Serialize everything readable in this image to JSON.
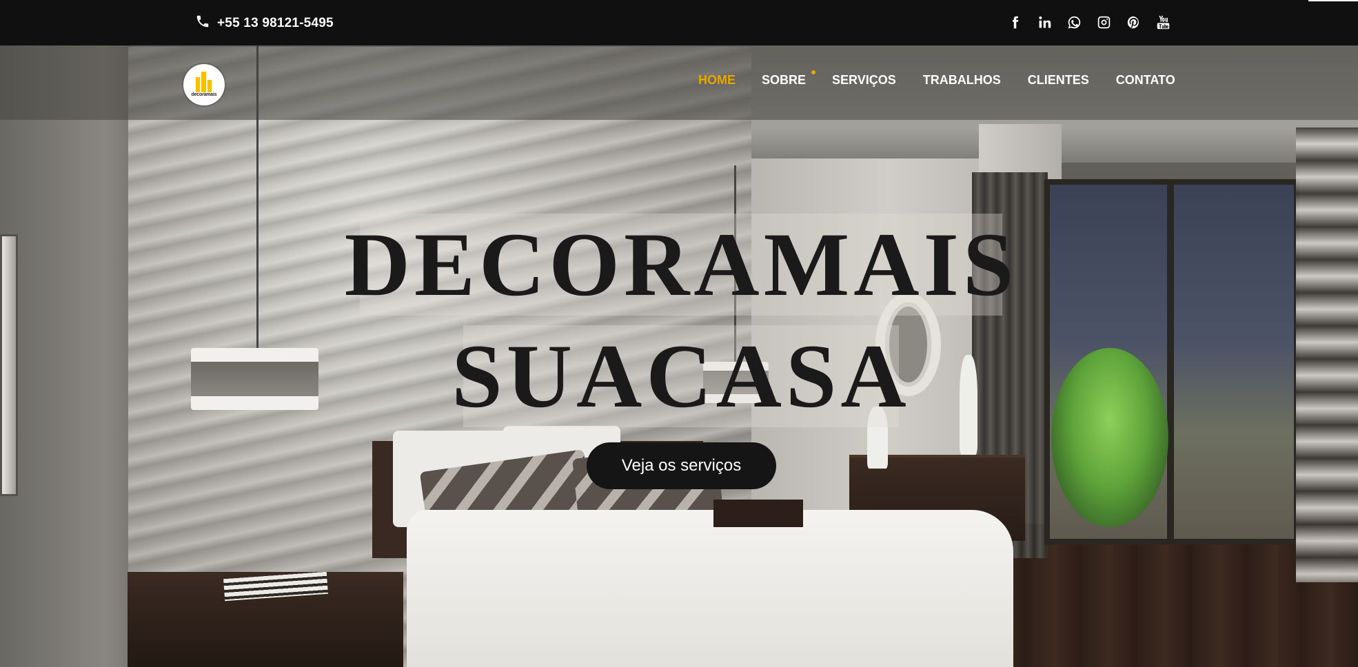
{
  "topbar": {
    "phone": "+55 13 98121-5495",
    "social_icons": [
      "facebook-icon",
      "linkedin-icon",
      "whatsapp-icon",
      "instagram-icon",
      "pinterest-icon",
      "youtube-icon"
    ]
  },
  "brand": {
    "logo_text": "decoramais"
  },
  "nav": {
    "items": [
      {
        "label": "HOME",
        "active": true
      },
      {
        "label": "SOBRE",
        "active": false
      },
      {
        "label": "SERVIÇOS",
        "active": false
      },
      {
        "label": "TRABALHOS",
        "active": false
      },
      {
        "label": "CLIENTES",
        "active": false
      },
      {
        "label": "CONTATO",
        "active": false
      }
    ]
  },
  "hero": {
    "title_line1": "DECORAMAIS",
    "title_line2": "SUACASA",
    "cta_label": "Veja os serviços"
  },
  "colors": {
    "topbar_bg": "#101010",
    "accent": "#e6a800",
    "cta_bg": "#151515",
    "logo_yellow": "#f5c000"
  }
}
